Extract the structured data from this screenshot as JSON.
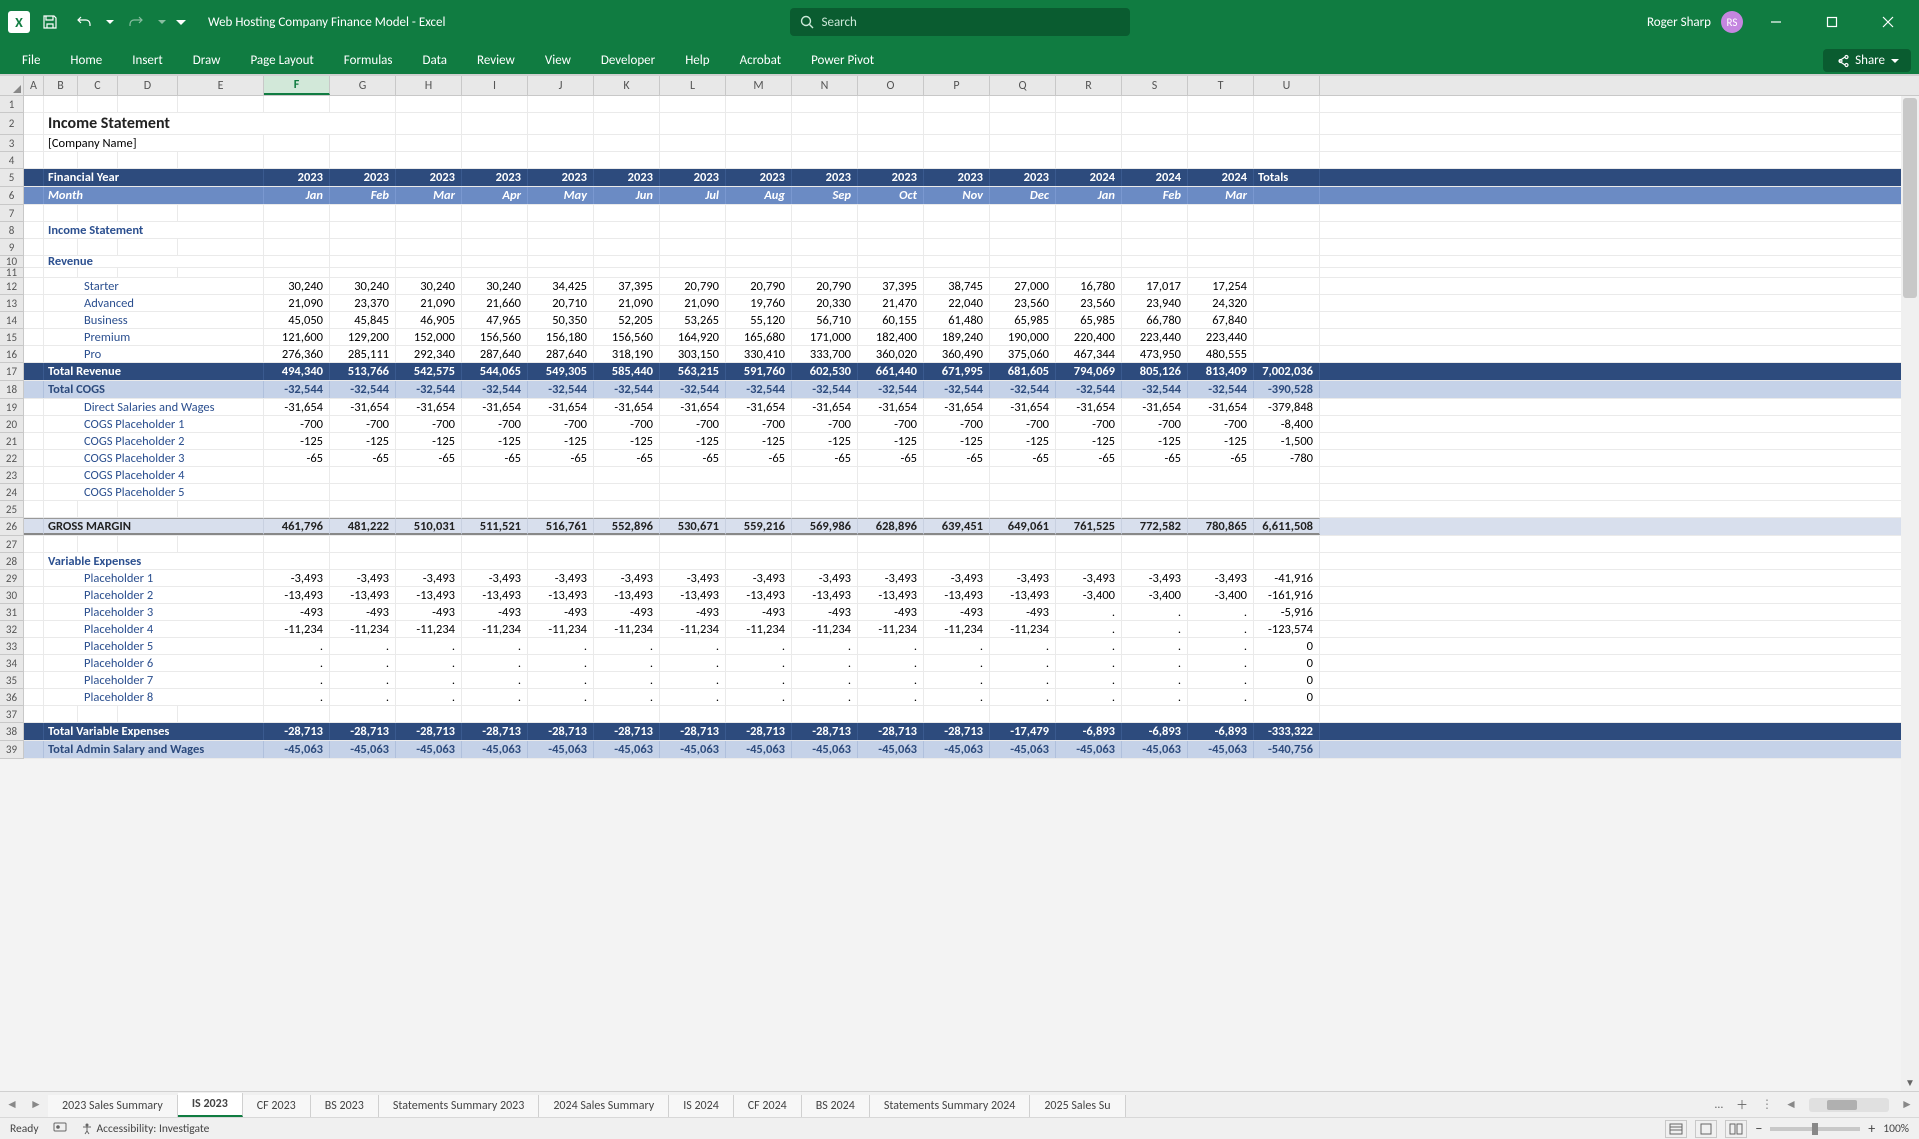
{
  "titlebar": {
    "doc_title": "Web Hosting Company Finance Model  -  Excel",
    "user_name": "Roger Sharp",
    "user_initials": "RS",
    "search_placeholder": "Search"
  },
  "ribbon": {
    "tabs": [
      "File",
      "Home",
      "Insert",
      "Draw",
      "Page Layout",
      "Formulas",
      "Data",
      "Review",
      "View",
      "Developer",
      "Help",
      "Acrobat",
      "Power Pivot"
    ],
    "active_index": 1,
    "share_label": "Share"
  },
  "columns": {
    "letters": [
      "A",
      "B",
      "C",
      "D",
      "E",
      "F",
      "G",
      "H",
      "I",
      "J",
      "K",
      "L",
      "M",
      "N",
      "O",
      "P",
      "Q",
      "R",
      "S",
      "T",
      "U"
    ],
    "widths": [
      20,
      34,
      40,
      60,
      86,
      66,
      66,
      66,
      66,
      66,
      66,
      66,
      66,
      66,
      66,
      66,
      66,
      66,
      66,
      66,
      66
    ],
    "selected": "F"
  },
  "rows": {
    "count": 39,
    "heights": {
      "1": 17,
      "2": 22,
      "3": 17,
      "4": 17,
      "5": 18,
      "6": 18,
      "7": 17,
      "8": 17,
      "9": 17,
      "10": 12,
      "11": 10,
      "12": 17,
      "13": 17,
      "14": 17,
      "15": 17,
      "16": 17,
      "17": 18,
      "18": 18,
      "19": 17,
      "20": 17,
      "21": 17,
      "22": 17,
      "23": 17,
      "24": 17,
      "25": 17,
      "26": 18,
      "27": 17,
      "28": 17,
      "29": 17,
      "30": 17,
      "31": 17,
      "32": 17,
      "33": 17,
      "34": 17,
      "35": 17,
      "36": 17,
      "37": 17,
      "38": 18,
      "39": 18
    }
  },
  "sheet": {
    "title": "Income Statement",
    "company": "[Company Name]",
    "fy_label": "Financial Year",
    "month_label": "Month",
    "totals_label": "Totals",
    "years": [
      "2023",
      "2023",
      "2023",
      "2023",
      "2023",
      "2023",
      "2023",
      "2023",
      "2023",
      "2023",
      "2023",
      "2023",
      "2024",
      "2024",
      "2024"
    ],
    "months": [
      "Jan",
      "Feb",
      "Mar",
      "Apr",
      "May",
      "Jun",
      "Jul",
      "Aug",
      "Sep",
      "Oct",
      "Nov",
      "Dec",
      "Jan",
      "Feb",
      "Mar"
    ],
    "section_is": "Income Statement",
    "section_rev": "Revenue",
    "section_varexp": "Variable Expenses",
    "lines": {
      "starter": {
        "label": "Starter",
        "vals": [
          "30,240",
          "30,240",
          "30,240",
          "30,240",
          "34,425",
          "37,395",
          "20,790",
          "20,790",
          "20,790",
          "37,395",
          "38,745",
          "27,000",
          "16,780",
          "17,017",
          "17,254"
        ],
        "total": ""
      },
      "advanced": {
        "label": "Advanced",
        "vals": [
          "21,090",
          "23,370",
          "21,090",
          "21,660",
          "20,710",
          "21,090",
          "21,090",
          "19,760",
          "20,330",
          "21,470",
          "22,040",
          "23,560",
          "23,560",
          "23,940",
          "24,320"
        ],
        "total": ""
      },
      "business": {
        "label": "Business",
        "vals": [
          "45,050",
          "45,845",
          "46,905",
          "47,965",
          "50,350",
          "52,205",
          "53,265",
          "55,120",
          "56,710",
          "60,155",
          "61,480",
          "65,985",
          "65,985",
          "66,780",
          "67,840"
        ],
        "total": ""
      },
      "premium": {
        "label": "Premium",
        "vals": [
          "121,600",
          "129,200",
          "152,000",
          "156,560",
          "156,180",
          "156,560",
          "164,920",
          "165,680",
          "171,000",
          "182,400",
          "189,240",
          "190,000",
          "220,400",
          "223,440",
          "223,440"
        ],
        "total": ""
      },
      "pro": {
        "label": "Pro",
        "vals": [
          "276,360",
          "285,111",
          "292,340",
          "287,640",
          "287,640",
          "318,190",
          "303,150",
          "330,410",
          "333,700",
          "360,020",
          "360,490",
          "375,060",
          "467,344",
          "473,950",
          "480,555"
        ],
        "total": ""
      },
      "totrev": {
        "label": "Total Revenue",
        "vals": [
          "494,340",
          "513,766",
          "542,575",
          "544,065",
          "549,305",
          "585,440",
          "563,215",
          "591,760",
          "602,530",
          "661,440",
          "671,995",
          "681,605",
          "794,069",
          "805,126",
          "813,409"
        ],
        "total": "7,002,036"
      },
      "totcogs": {
        "label": "Total COGS",
        "vals": [
          "-32,544",
          "-32,544",
          "-32,544",
          "-32,544",
          "-32,544",
          "-32,544",
          "-32,544",
          "-32,544",
          "-32,544",
          "-32,544",
          "-32,544",
          "-32,544",
          "-32,544",
          "-32,544",
          "-32,544"
        ],
        "total": "-390,528"
      },
      "dsw": {
        "label": "Direct Salaries and Wages",
        "vals": [
          "-31,654",
          "-31,654",
          "-31,654",
          "-31,654",
          "-31,654",
          "-31,654",
          "-31,654",
          "-31,654",
          "-31,654",
          "-31,654",
          "-31,654",
          "-31,654",
          "-31,654",
          "-31,654",
          "-31,654"
        ],
        "total": "-379,848"
      },
      "cp1": {
        "label": "COGS Placeholder 1",
        "vals": [
          "-700",
          "-700",
          "-700",
          "-700",
          "-700",
          "-700",
          "-700",
          "-700",
          "-700",
          "-700",
          "-700",
          "-700",
          "-700",
          "-700",
          "-700"
        ],
        "total": "-8,400"
      },
      "cp2": {
        "label": "COGS Placeholder 2",
        "vals": [
          "-125",
          "-125",
          "-125",
          "-125",
          "-125",
          "-125",
          "-125",
          "-125",
          "-125",
          "-125",
          "-125",
          "-125",
          "-125",
          "-125",
          "-125"
        ],
        "total": "-1,500"
      },
      "cp3": {
        "label": "COGS Placeholder 3",
        "vals": [
          "-65",
          "-65",
          "-65",
          "-65",
          "-65",
          "-65",
          "-65",
          "-65",
          "-65",
          "-65",
          "-65",
          "-65",
          "-65",
          "-65",
          "-65"
        ],
        "total": "-780"
      },
      "cp4": {
        "label": "COGS Placeholder 4",
        "vals": [
          "",
          "",
          "",
          "",
          "",
          "",
          "",
          "",
          "",
          "",
          "",
          "",
          "",
          "",
          ""
        ],
        "total": ""
      },
      "cp5": {
        "label": "COGS Placeholder 5",
        "vals": [
          "",
          "",
          "",
          "",
          "",
          "",
          "",
          "",
          "",
          "",
          "",
          "",
          "",
          "",
          ""
        ],
        "total": ""
      },
      "gross": {
        "label": "GROSS MARGIN",
        "vals": [
          "461,796",
          "481,222",
          "510,031",
          "511,521",
          "516,761",
          "552,896",
          "530,671",
          "559,216",
          "569,986",
          "628,896",
          "639,451",
          "649,061",
          "761,525",
          "772,582",
          "780,865"
        ],
        "total": "6,611,508"
      },
      "ph1": {
        "label": "Placeholder 1",
        "vals": [
          "-3,493",
          "-3,493",
          "-3,493",
          "-3,493",
          "-3,493",
          "-3,493",
          "-3,493",
          "-3,493",
          "-3,493",
          "-3,493",
          "-3,493",
          "-3,493",
          "-3,493",
          "-3,493",
          "-3,493"
        ],
        "total": "-41,916"
      },
      "ph2": {
        "label": "Placeholder 2",
        "vals": [
          "-13,493",
          "-13,493",
          "-13,493",
          "-13,493",
          "-13,493",
          "-13,493",
          "-13,493",
          "-13,493",
          "-13,493",
          "-13,493",
          "-13,493",
          "-13,493",
          "-3,400",
          "-3,400",
          "-3,400"
        ],
        "total": "-161,916"
      },
      "ph3": {
        "label": "Placeholder 3",
        "vals": [
          "-493",
          "-493",
          "-493",
          "-493",
          "-493",
          "-493",
          "-493",
          "-493",
          "-493",
          "-493",
          "-493",
          "-493",
          ".",
          ".",
          "."
        ],
        "total": "-5,916"
      },
      "ph4": {
        "label": "Placeholder 4",
        "vals": [
          "-11,234",
          "-11,234",
          "-11,234",
          "-11,234",
          "-11,234",
          "-11,234",
          "-11,234",
          "-11,234",
          "-11,234",
          "-11,234",
          "-11,234",
          "-11,234",
          ".",
          ".",
          "."
        ],
        "total": "-123,574"
      },
      "ph5": {
        "label": "Placeholder 5",
        "vals": [
          ".",
          ".",
          ".",
          ".",
          ".",
          ".",
          ".",
          ".",
          ".",
          ".",
          ".",
          ".",
          ".",
          ".",
          "."
        ],
        "total": "0"
      },
      "ph6": {
        "label": "Placeholder 6",
        "vals": [
          ".",
          ".",
          ".",
          ".",
          ".",
          ".",
          ".",
          ".",
          ".",
          ".",
          ".",
          ".",
          ".",
          ".",
          "."
        ],
        "total": "0"
      },
      "ph7": {
        "label": "Placeholder 7",
        "vals": [
          ".",
          ".",
          ".",
          ".",
          ".",
          ".",
          ".",
          ".",
          ".",
          ".",
          ".",
          ".",
          ".",
          ".",
          "."
        ],
        "total": "0"
      },
      "ph8": {
        "label": "Placeholder 8",
        "vals": [
          ".",
          ".",
          ".",
          ".",
          ".",
          ".",
          ".",
          ".",
          ".",
          ".",
          ".",
          ".",
          ".",
          ".",
          "."
        ],
        "total": "0"
      },
      "totvar": {
        "label": "Total Variable Expenses",
        "vals": [
          "-28,713",
          "-28,713",
          "-28,713",
          "-28,713",
          "-28,713",
          "-28,713",
          "-28,713",
          "-28,713",
          "-28,713",
          "-28,713",
          "-28,713",
          "-17,479",
          "-6,893",
          "-6,893",
          "-6,893"
        ],
        "total": "-333,322"
      },
      "totadmin": {
        "label": "Total Admin Salary and Wages",
        "vals": [
          "-45,063",
          "-45,063",
          "-45,063",
          "-45,063",
          "-45,063",
          "-45,063",
          "-45,063",
          "-45,063",
          "-45,063",
          "-45,063",
          "-45,063",
          "-45,063",
          "-45,063",
          "-45,063",
          "-45,063"
        ],
        "total": "-540,756"
      }
    }
  },
  "sheet_tabs": {
    "tabs": [
      "2023 Sales Summary",
      "IS 2023",
      "CF 2023",
      "BS 2023",
      "Statements Summary 2023",
      "2024 Sales Summary",
      "IS 2024",
      "CF 2024",
      "BS 2024",
      "Statements Summary 2024",
      "2025 Sales Su"
    ],
    "active_index": 1
  },
  "status": {
    "ready": "Ready",
    "accessibility": "Accessibility: Investigate",
    "zoom": "100%"
  }
}
